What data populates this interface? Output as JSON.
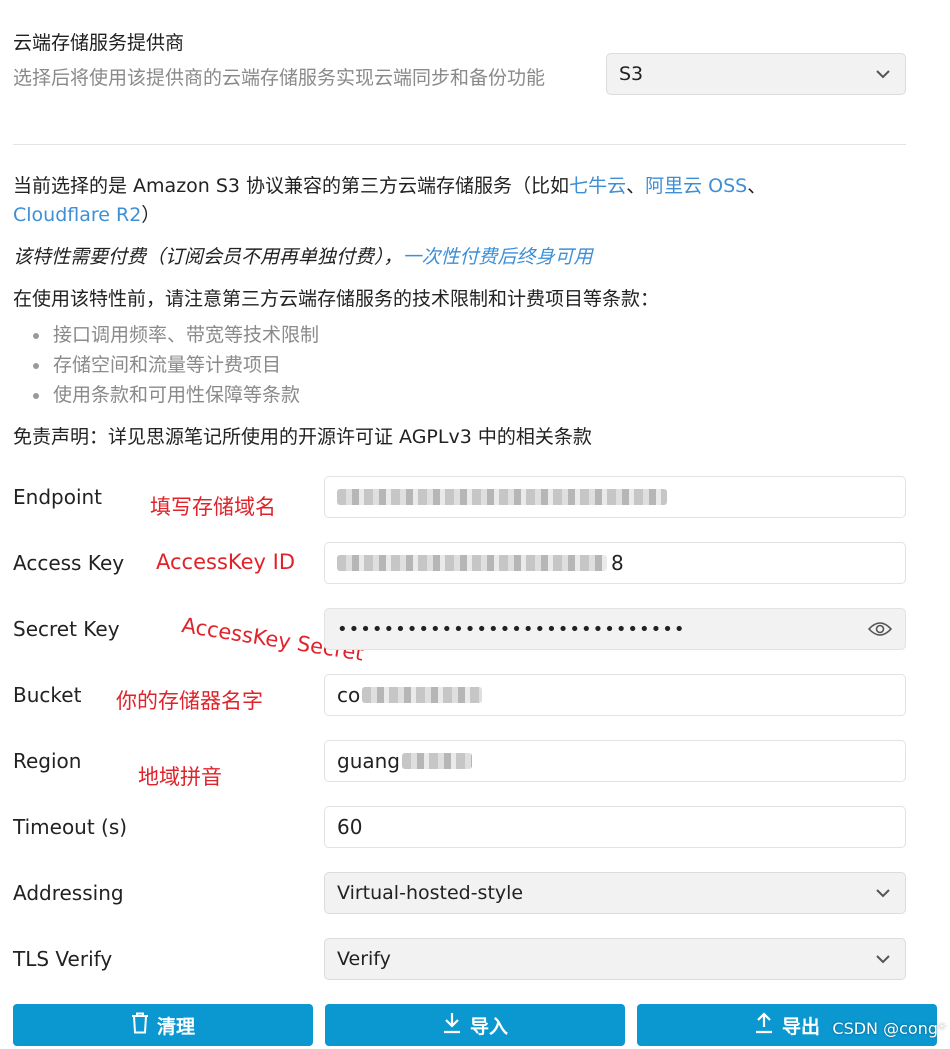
{
  "provider": {
    "title": "云端存储服务提供商",
    "description": "选择后将使用该提供商的云端存储服务实现云端同步和备份功能",
    "selected": "S3"
  },
  "intro": {
    "prefix": "当前选择的是 Amazon S3 协议兼容的第三方云端存储服务（比如",
    "links": [
      "七牛云",
      "阿里云 OSS",
      "Cloudflare R2"
    ],
    "separator": "、",
    "suffix": "）"
  },
  "fee": {
    "text": "该特性需要付费（订阅会员不用再单独付费），",
    "link": "一次性付费后终身可用"
  },
  "notice": {
    "text": "在使用该特性前，请注意第三方云端存储服务的技术限制和计费项目等条款：",
    "items": [
      "接口调用频率、带宽等技术限制",
      "存储空间和流量等计费项目",
      "使用条款和可用性保障等条款"
    ]
  },
  "disclaimer": "免责声明：详见思源笔记所使用的开源许可证 AGPLv3 中的相关条款",
  "fields": {
    "endpoint": {
      "label": "Endpoint",
      "annotation": "填写存储域名"
    },
    "access_key": {
      "label": "Access Key",
      "annotation": "AccessKey ID",
      "visible_tail": "8"
    },
    "secret_key": {
      "label": "Secret Key",
      "annotation": "AccessKey Secret",
      "masked": "••••••••••••••••••••••••••••••"
    },
    "bucket": {
      "label": "Bucket",
      "annotation": "你的存储器名字",
      "visible_prefix": "co"
    },
    "region": {
      "label": "Region",
      "annotation": "地域拼音",
      "visible_prefix": "guang"
    },
    "timeout": {
      "label": "Timeout (s)",
      "value": "60"
    },
    "addressing": {
      "label": "Addressing",
      "value": "Virtual-hosted-style"
    },
    "tls_verify": {
      "label": "TLS Verify",
      "value": "Verify"
    }
  },
  "buttons": {
    "purge": "清理",
    "import": "导入",
    "export": "导出"
  },
  "watermark": "CSDN @cong*",
  "colors": {
    "accent": "#0b97cf",
    "link": "#3d8fd6",
    "annotation": "#e0232a"
  }
}
